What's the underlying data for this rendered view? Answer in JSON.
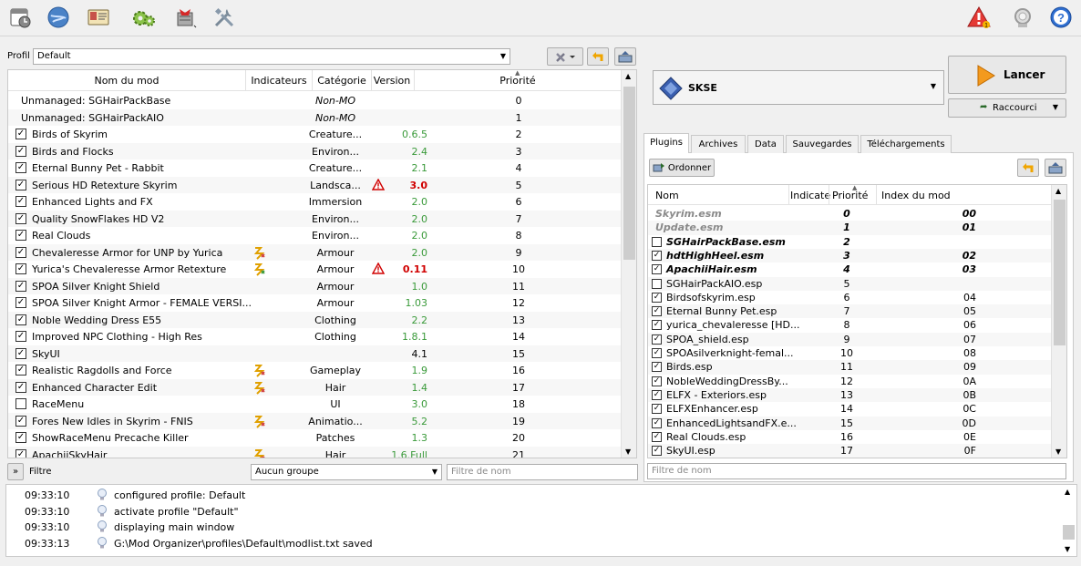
{
  "toolbar": {
    "icons": [
      "instance-icon",
      "nexus-icon",
      "profiles-icon",
      "executables-icon",
      "tools-icon",
      "settings-icon",
      "problems-icon",
      "update-icon",
      "help-icon"
    ]
  },
  "profile": {
    "label": "Profil",
    "value": "Default"
  },
  "modlist": {
    "headers": {
      "name": "Nom du mod",
      "flags": "Indicateurs",
      "category": "Catégorie",
      "version": "Version",
      "priority": "Priorité"
    },
    "rows": [
      {
        "checked": null,
        "name": "Unmanaged: SGHairPackBase",
        "category": "Non-MO",
        "version": "",
        "priority": "0",
        "italic_cat": true
      },
      {
        "checked": null,
        "name": "Unmanaged: SGHairPackAIO",
        "category": "Non-MO",
        "version": "",
        "priority": "1",
        "italic_cat": true
      },
      {
        "checked": true,
        "name": "Birds of Skyrim",
        "category": "Creature...",
        "version": "0.6.5",
        "priority": "2"
      },
      {
        "checked": true,
        "name": "Birds and Flocks",
        "category": "Environ...",
        "version": "2.4",
        "priority": "3"
      },
      {
        "checked": true,
        "name": "Eternal Bunny Pet - Rabbit",
        "category": "Creature...",
        "version": "2.1",
        "priority": "4"
      },
      {
        "checked": true,
        "name": "Serious HD Retexture Skyrim",
        "category": "Landsca...",
        "version": "3.0",
        "priority": "5",
        "warn": true
      },
      {
        "checked": true,
        "name": "Enhanced Lights and FX",
        "category": "Immersion",
        "version": "2.0",
        "priority": "6"
      },
      {
        "checked": true,
        "name": "Quality SnowFlakes HD V2",
        "category": "Environ...",
        "version": "2.0",
        "priority": "7"
      },
      {
        "checked": true,
        "name": "Real Clouds",
        "category": "Environ...",
        "version": "2.0",
        "priority": "8"
      },
      {
        "checked": true,
        "name": "Chevaleresse Armor for UNP by Yurica",
        "category": "Armour",
        "version": "2.0",
        "priority": "9",
        "flag": "conflict-red"
      },
      {
        "checked": true,
        "name": "Yurica's Chevaleresse Armor Retexture",
        "category": "Armour",
        "version": "0.11",
        "priority": "10",
        "flag": "conflict-green",
        "warn": true
      },
      {
        "checked": true,
        "name": "SPOA Silver Knight Shield",
        "category": "Armour",
        "version": "1.0",
        "priority": "11"
      },
      {
        "checked": true,
        "name": "SPOA Silver Knight Armor - FEMALE VERSI...",
        "category": "Armour",
        "version": "1.03",
        "priority": "12"
      },
      {
        "checked": true,
        "name": "Noble Wedding Dress E55",
        "category": "Clothing",
        "version": "2.2",
        "priority": "13"
      },
      {
        "checked": true,
        "name": "Improved NPC Clothing - High Res",
        "category": "Clothing",
        "version": "1.8.1",
        "priority": "14"
      },
      {
        "checked": true,
        "name": "SkyUI",
        "category": "",
        "version": "4.1",
        "priority": "15",
        "black_ver": true
      },
      {
        "checked": true,
        "name": "Realistic Ragdolls and Force",
        "category": "Gameplay",
        "version": "1.9",
        "priority": "16",
        "flag": "conflict-red"
      },
      {
        "checked": true,
        "name": "Enhanced Character Edit",
        "category": "Hair",
        "version": "1.4",
        "priority": "17",
        "flag": "conflict-red"
      },
      {
        "checked": false,
        "name": "RaceMenu",
        "category": "UI",
        "version": "3.0",
        "priority": "18"
      },
      {
        "checked": true,
        "name": "Fores New Idles in Skyrim - FNIS",
        "category": "Animatio...",
        "version": "5.2",
        "priority": "19",
        "flag": "conflict-red"
      },
      {
        "checked": true,
        "name": "ShowRaceMenu Precache Killer",
        "category": "Patches",
        "version": "1.3",
        "priority": "20"
      },
      {
        "checked": true,
        "name": "ApachiiSkyHair",
        "category": "Hair",
        "version": "1.6.Full",
        "priority": "21",
        "flag": "conflict-red"
      }
    ]
  },
  "filter": {
    "toggle": "»",
    "label": "Filtre",
    "group": "Aucun groupe",
    "name_placeholder": "Filtre de nom"
  },
  "executable": {
    "value": "SKSE"
  },
  "launch": {
    "label": "Lancer"
  },
  "shortcut": {
    "label": "Raccourci"
  },
  "tabs": [
    "Plugins",
    "Archives",
    "Data",
    "Sauvegardes",
    "Téléchargements"
  ],
  "plugins": {
    "sort_button": "Ordonner",
    "headers": {
      "name": "Nom",
      "flags": "Indicate",
      "priority": "Priorité",
      "index": "Index du mod"
    },
    "rows": [
      {
        "checked": null,
        "name": "Skyrim.esm",
        "priority": "0",
        "index": "00",
        "style": "gray-bi"
      },
      {
        "checked": null,
        "name": "Update.esm",
        "priority": "1",
        "index": "01",
        "style": "gray-bi"
      },
      {
        "checked": false,
        "name": "SGHairPackBase.esm",
        "priority": "2",
        "index": "",
        "style": "bi"
      },
      {
        "checked": true,
        "name": "hdtHighHeel.esm",
        "priority": "3",
        "index": "02",
        "style": "bi"
      },
      {
        "checked": true,
        "name": "ApachiiHair.esm",
        "priority": "4",
        "index": "03",
        "style": "bi"
      },
      {
        "checked": false,
        "name": "SGHairPackAIO.esp",
        "priority": "5",
        "index": "",
        "style": ""
      },
      {
        "checked": true,
        "name": "Birdsofskyrim.esp",
        "priority": "6",
        "index": "04",
        "style": ""
      },
      {
        "checked": true,
        "name": "Eternal Bunny Pet.esp",
        "priority": "7",
        "index": "05",
        "style": ""
      },
      {
        "checked": true,
        "name": "yurica_chevaleresse [HD...",
        "priority": "8",
        "index": "06",
        "style": ""
      },
      {
        "checked": true,
        "name": "SPOA_shield.esp",
        "priority": "9",
        "index": "07",
        "style": ""
      },
      {
        "checked": true,
        "name": "SPOAsilverknight-femal...",
        "priority": "10",
        "index": "08",
        "style": ""
      },
      {
        "checked": true,
        "name": "Birds.esp",
        "priority": "11",
        "index": "09",
        "style": ""
      },
      {
        "checked": true,
        "name": "NobleWeddingDressBy...",
        "priority": "12",
        "index": "0A",
        "style": ""
      },
      {
        "checked": true,
        "name": "ELFX - Exteriors.esp",
        "priority": "13",
        "index": "0B",
        "style": ""
      },
      {
        "checked": true,
        "name": "ELFXEnhancer.esp",
        "priority": "14",
        "index": "0C",
        "style": ""
      },
      {
        "checked": true,
        "name": "EnhancedLightsandFX.e...",
        "priority": "15",
        "index": "0D",
        "style": ""
      },
      {
        "checked": true,
        "name": "Real Clouds.esp",
        "priority": "16",
        "index": "0E",
        "style": ""
      },
      {
        "checked": true,
        "name": "SkyUI.esp",
        "priority": "17",
        "index": "0F",
        "style": ""
      }
    ],
    "filter_placeholder": "Filtre de nom"
  },
  "log": [
    {
      "time": "09:33:10",
      "msg": "configured profile: Default"
    },
    {
      "time": "09:33:10",
      "msg": "activate profile \"Default\""
    },
    {
      "time": "09:33:10",
      "msg": "displaying main window"
    },
    {
      "time": "09:33:13",
      "msg": "G:\\Mod Organizer\\profiles\\Default\\modlist.txt saved"
    }
  ],
  "colors": {
    "version_green": "#3a9a3a",
    "warn_red": "#d00000",
    "launch_orange": "#f39a1e"
  }
}
